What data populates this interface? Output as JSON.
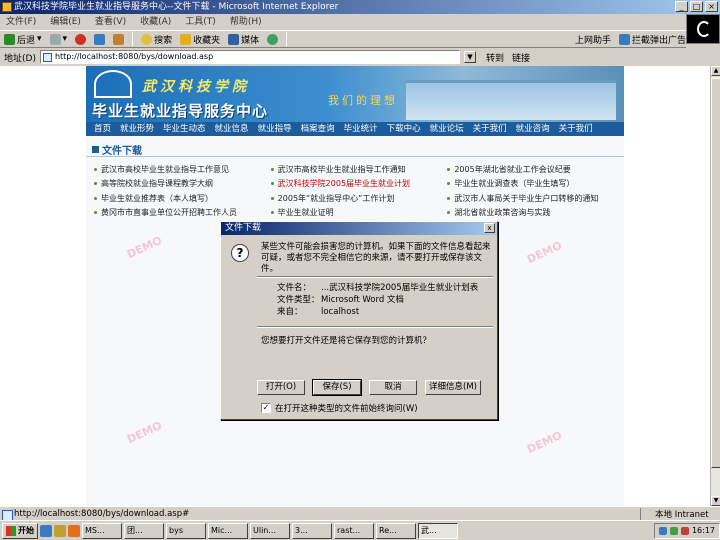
{
  "window": {
    "title": "武汉科技学院毕业生就业指导服务中心--文件下载 - Microsoft Internet Explorer"
  },
  "menu": [
    "文件(F)",
    "编辑(E)",
    "查看(V)",
    "收藏(A)",
    "工具(T)",
    "帮助(H)"
  ],
  "toolbar": {
    "back": "后退",
    "forward": "",
    "stop": "",
    "refresh": "",
    "home": "",
    "search": "搜索",
    "favorites": "收藏夹",
    "media": "媒体",
    "history": "",
    "right_buttons": [
      "转到",
      "链接",
      "上网助手",
      "拦截弹出广告"
    ]
  },
  "address": {
    "label": "地址(D)",
    "value": "http://localhost:8080/bys/download.asp",
    "go": "转到",
    "links": "链接"
  },
  "page": {
    "school": "武汉科技学院",
    "center": "毕业生就业指导服务中心",
    "slogan": "我们的理想",
    "nav": [
      "首页",
      "就业形势",
      "毕业生动态",
      "就业信息",
      "就业指导",
      "档案查询",
      "毕业统计",
      "下载中心",
      "就业论坛",
      "关于我们",
      "就业咨询",
      "关于我们"
    ],
    "section_title": "文件下载",
    "links": [
      [
        "武汉市高校毕业生就业指导工作意见",
        "武汉市高校毕业生就业指导工作通知",
        "2005年湖北省就业工作会议纪要"
      ],
      [
        "高等院校就业指导课程教学大纲",
        "武汉科技学院2005届毕业生就业计划",
        "毕业生就业调查表（毕业生填写）"
      ],
      [
        "毕业生就业推荐表（本人填写）",
        "2005年“就业指导中心”工作计划",
        "武汉市人事局关于毕业生户口转移的通知"
      ],
      [
        "黄冈市市直事业单位公开招聘工作人员",
        "毕业生就业证明",
        "湖北省就业政策咨询与实践"
      ]
    ],
    "watermark": "DEMO"
  },
  "dialog": {
    "title": "文件下载",
    "close": "x",
    "warning": "某些文件可能会损害您的计算机。如果下面的文件信息看起来可疑，或者您不完全相信它的来源，请不要打开或保存该文件。",
    "file_name_label": "文件名：",
    "file_name": "...武汉科技学院2005届毕业生就业计划表",
    "file_type_label": "文件类型：",
    "file_type": "Microsoft Word 文档",
    "from_label": "来自：",
    "from": "localhost",
    "question": "您想要打开文件还是将它保存到您的计算机？",
    "buttons": [
      "打开(O)",
      "保存(S)",
      "取消",
      "详细信息(M)"
    ],
    "checkbox": "在打开这种类型的文件前始终询问(W)",
    "checked": true
  },
  "status": {
    "text": "http://localhost:8080/bys/download.asp#",
    "zone": "本地 Intranet"
  },
  "taskbar": {
    "start": "开始",
    "tasks": [
      "MS...",
      "团...",
      "bys",
      "Mic...",
      "Ulin...",
      "3...",
      "rast...",
      "Re...",
      "武..."
    ],
    "clock": "16:17"
  },
  "colors": {
    "title_gradient_start": "#0a246a",
    "banner_blue": "#1a6fb8",
    "nav_blue": "#1c5c9c",
    "link_red": "#c00000"
  }
}
